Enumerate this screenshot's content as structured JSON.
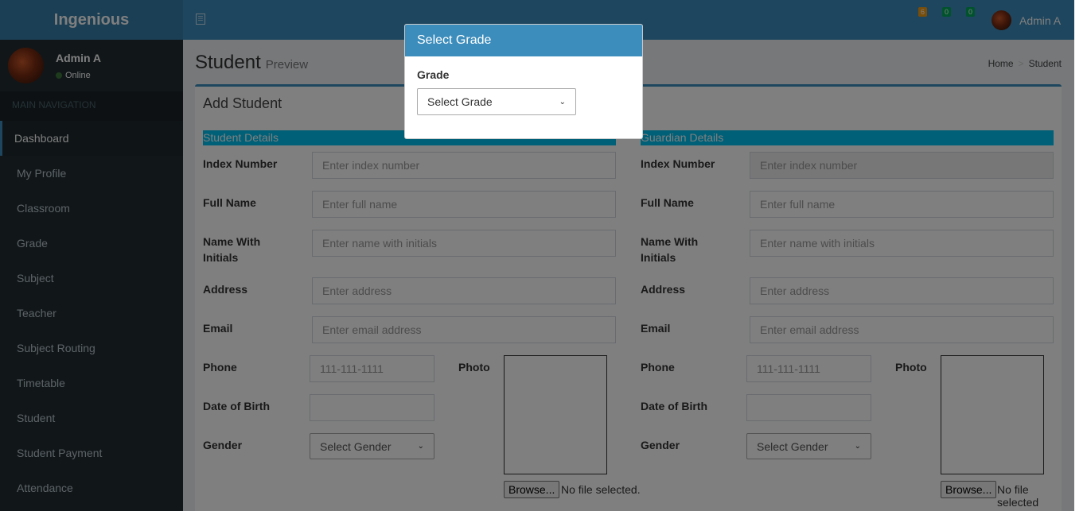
{
  "app": {
    "logo": "Ingenious"
  },
  "user": {
    "name": "Admin A",
    "status": "Online"
  },
  "sidebar": {
    "header": "MAIN NAVIGATION",
    "items": [
      {
        "label": "Dashboard"
      },
      {
        "label": "My Profile"
      },
      {
        "label": "Classroom"
      },
      {
        "label": "Grade"
      },
      {
        "label": "Subject"
      },
      {
        "label": "Teacher"
      },
      {
        "label": "Subject Routing"
      },
      {
        "label": "Timetable"
      },
      {
        "label": "Student"
      },
      {
        "label": "Student Payment"
      },
      {
        "label": "Attendance"
      }
    ]
  },
  "topbar": {
    "badges": [
      "6",
      "0",
      "0"
    ],
    "user_name": "Admin A"
  },
  "page": {
    "title": "Student",
    "subtitle": "Preview",
    "breadcrumb": [
      "Home",
      "Student"
    ],
    "box_title": "Add Student"
  },
  "student": {
    "section": "Student Details",
    "labels": {
      "index": "Index Number",
      "full_name": "Full Name",
      "initials_1": "Name With",
      "initials_2": "Initials",
      "address": "Address",
      "email": "Email",
      "phone": "Phone",
      "dob": "Date of Birth",
      "gender": "Gender",
      "photo": "Photo"
    },
    "placeholders": {
      "index": "Enter index number",
      "full_name": "Enter full name",
      "initials": "Enter name with initials",
      "address": "Enter address",
      "email": "Enter email address",
      "phone": "111-111-1111"
    },
    "gender_select": "Select Gender",
    "browse": "Browse...",
    "no_file": "No file selected."
  },
  "guardian": {
    "section": "Guardian Details",
    "labels": {
      "index": "Index Number",
      "full_name": "Full Name",
      "initials_1": "Name With",
      "initials_2": "Initials",
      "address": "Address",
      "email": "Email",
      "phone": "Phone",
      "dob": "Date of Birth",
      "gender": "Gender",
      "photo": "Photo"
    },
    "placeholders": {
      "index": "Enter index number",
      "full_name": "Enter full name",
      "initials": "Enter name with initials",
      "address": "Enter address",
      "email": "Enter email address",
      "phone": "111-111-1111"
    },
    "gender_select": "Select Gender",
    "browse": "Browse...",
    "no_file": "No file selected"
  },
  "modal": {
    "title": "Select Grade",
    "label": "Grade",
    "select": "Select Grade"
  },
  "colors": {
    "sidebar": "#222d32",
    "topbar": "#3c8dbc",
    "logo_bg": "#367fa9",
    "section_bar": "#00c0ef"
  }
}
